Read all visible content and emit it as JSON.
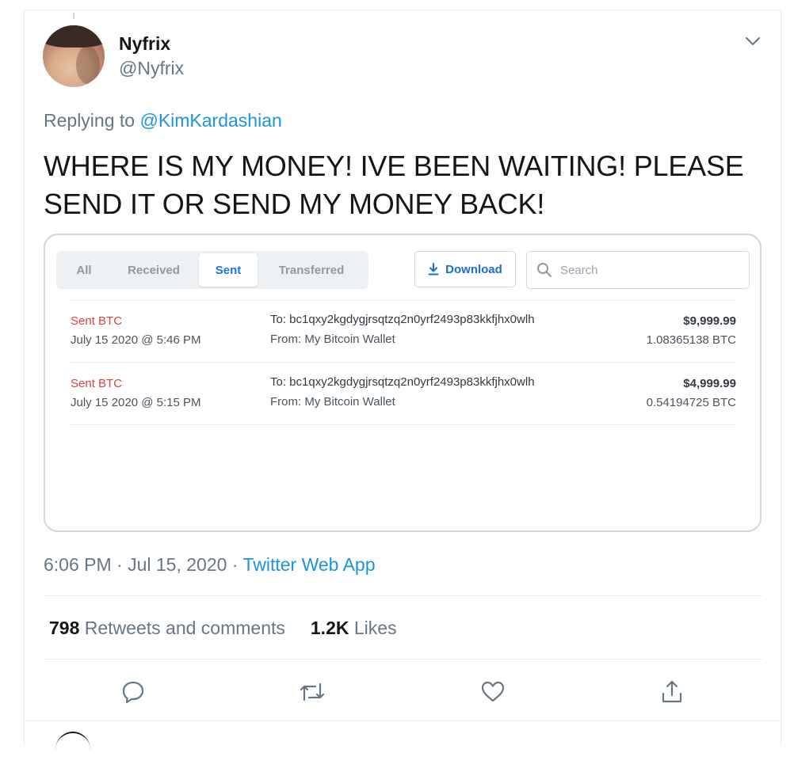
{
  "tweet": {
    "author": {
      "display_name": "Nyfrix",
      "handle": "@Nyfrix"
    },
    "replying_prefix": "Replying to",
    "replying_to": "@KimKardashian",
    "text": "WHERE IS MY MONEY! IVE BEEN WAITING! PLEASE SEND IT OR SEND MY MONEY BACK!",
    "timestamp": "6:06 PM · Jul 15, 2020 ·",
    "source": "Twitter Web App",
    "stats": {
      "retweets_count": "798",
      "retweets_label": "Retweets and comments",
      "likes_count": "1.2K",
      "likes_label": "Likes"
    }
  },
  "media": {
    "tabs": [
      {
        "label": "All",
        "active": false
      },
      {
        "label": "Received",
        "active": false
      },
      {
        "label": "Sent",
        "active": true
      },
      {
        "label": "Transferred",
        "active": false
      }
    ],
    "download_label": "Download",
    "search_placeholder": "Search",
    "transactions": [
      {
        "type": "Sent BTC",
        "date": "July 15 2020 @ 5:46 PM",
        "to": "To: bc1qxy2kgdygjrsqtzq2n0yrf2493p83kkfjhx0wlh",
        "from": "From: My Bitcoin Wallet",
        "usd": "$9,999.99",
        "btc": "1.08365138 BTC"
      },
      {
        "type": "Sent BTC",
        "date": "July 15 2020 @ 5:15 PM",
        "to": "To: bc1qxy2kgdygjrsqtzq2n0yrf2493p83kkfjhx0wlh",
        "from": "From: My Bitcoin Wallet",
        "usd": "$4,999.99",
        "btc": "0.54194725 BTC"
      }
    ]
  },
  "colors": {
    "link_blue": "#1b95e0",
    "sent_red": "#d9423b",
    "tab_active_blue": "#1a73e8",
    "secondary_gray": "#657786"
  },
  "icons": [
    "chevron-down-icon",
    "download-icon",
    "search-icon",
    "reply-icon",
    "retweet-icon",
    "like-icon",
    "share-icon"
  ]
}
